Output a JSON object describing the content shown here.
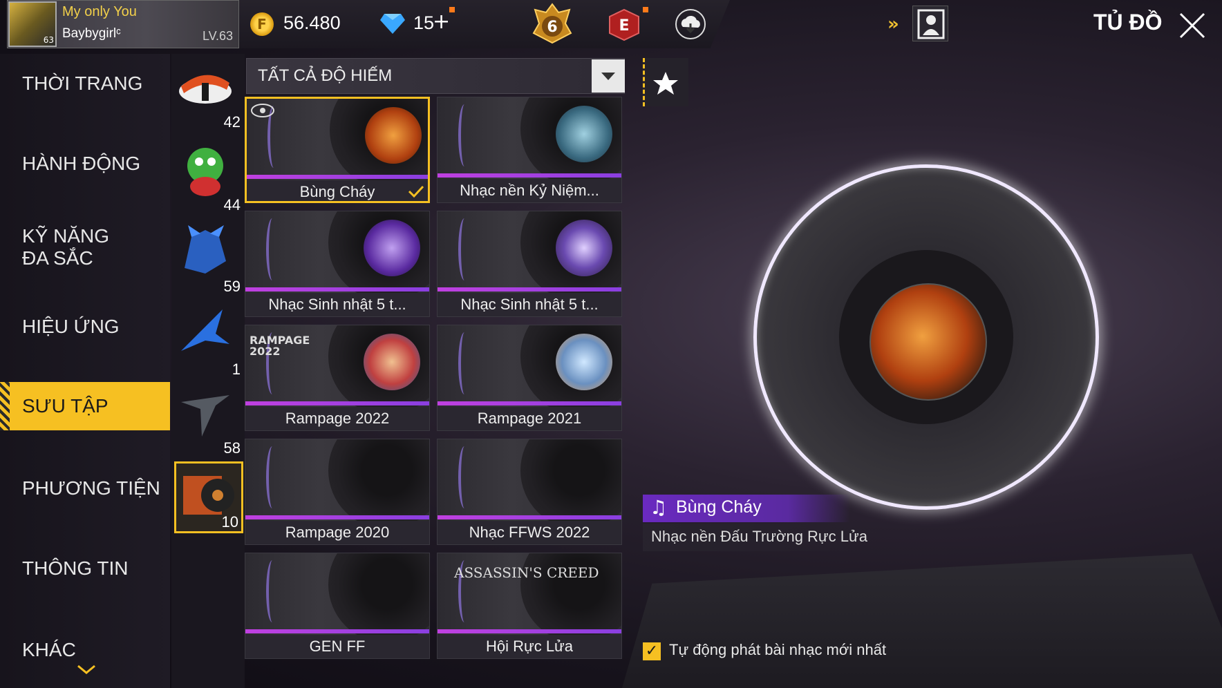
{
  "player": {
    "title": "My only  You",
    "name": "Baybygirlᶜ",
    "level": "LV.63",
    "avatar_level": "63"
  },
  "currency": {
    "gold": "56.480",
    "gold_icon": "F",
    "diamonds": "15",
    "diamond_plus": "+"
  },
  "rank_badge": "6",
  "elite_badge": "E",
  "page_title": "TỦ ĐỒ",
  "nav": {
    "items": [
      {
        "label": "THỜI TRANG"
      },
      {
        "label": "HÀNH ĐỘNG"
      },
      {
        "label": "KỸ NĂNG ĐA SẮC"
      },
      {
        "label": "HIỆU ỨNG"
      },
      {
        "label": "SƯU TẬP"
      },
      {
        "label": "PHƯƠNG TIỆN"
      },
      {
        "label": "THÔNG TIN"
      },
      {
        "label": "KHÁC"
      }
    ]
  },
  "categories": [
    {
      "count": "42",
      "icon": "sushi-icon"
    },
    {
      "count": "44",
      "icon": "dragon-pet-icon"
    },
    {
      "count": "59",
      "icon": "blue-beast-icon"
    },
    {
      "count": "1",
      "icon": "blue-bird-icon"
    },
    {
      "count": "58",
      "icon": "glider-icon"
    },
    {
      "count": "10",
      "icon": "music-album-icon"
    }
  ],
  "filter": {
    "label": "TẤT CẢ ĐỘ HIẾM"
  },
  "items": [
    {
      "label": "Bùng Cháy"
    },
    {
      "label": "Nhạc nền Kỷ Niệm..."
    },
    {
      "label": "Nhạc Sinh nhật 5 t..."
    },
    {
      "label": "Nhạc Sinh nhật 5 t..."
    },
    {
      "label": "Rampage 2022",
      "badge": "RAMPAGE 2022"
    },
    {
      "label": "Rampage 2021"
    },
    {
      "label": "Rampage 2020"
    },
    {
      "label": "Nhạc FFWS 2022"
    },
    {
      "label": "GEN FF"
    },
    {
      "label": "Hội Rực Lửa",
      "badge": "ASSASSIN'S CREED"
    }
  ],
  "preview": {
    "title": "Bùng Cháy",
    "subtitle": "Nhạc nền Đấu Trường Rực Lửa"
  },
  "autoplay": {
    "label": "Tự động phát bài nhạc mới nhất",
    "checked": true
  },
  "colors": {
    "accent": "#f6c022",
    "purple": "#8a3fe0"
  }
}
